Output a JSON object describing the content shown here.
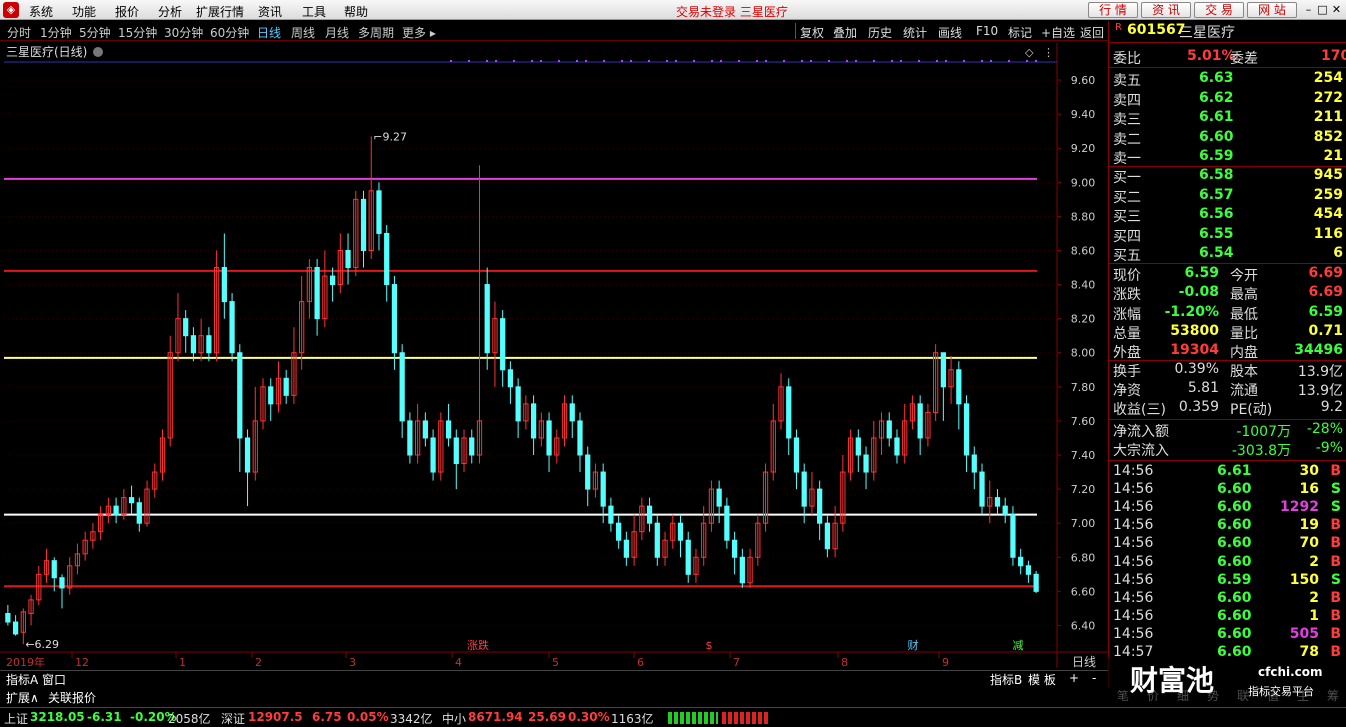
{
  "menu": {
    "items": [
      "系统",
      "功能",
      "报价",
      "分析",
      "扩展行情",
      "资讯",
      "工具",
      "帮助"
    ],
    "title": "交易未登录  三星医疗",
    "tabs": [
      "行 情",
      "资 讯",
      "交 易",
      "网 站"
    ]
  },
  "periods": [
    "分时",
    "1分钟",
    "5分钟",
    "15分钟",
    "30分钟",
    "60分钟",
    "日线",
    "周线",
    "月线",
    "多周期",
    "更多 ▸"
  ],
  "active_period": "日线",
  "tools": [
    "复权",
    "叠加",
    "历史",
    "统计",
    "画线",
    "F10",
    "标记",
    "+自选",
    "返回"
  ],
  "chart_title": "三星医疗(日线)",
  "chart_data": {
    "type": "candlestick",
    "title": "三星医疗(日线)",
    "ylim": [
      6.25,
      9.7
    ],
    "yticks": [
      "9.60",
      "9.40",
      "9.20",
      "9.00",
      "8.80",
      "8.60",
      "8.40",
      "8.20",
      "8.00",
      "7.80",
      "7.60",
      "7.40",
      "7.20",
      "7.00",
      "6.80",
      "6.60",
      "6.40"
    ],
    "x_year": "2019年",
    "x_months": [
      "12",
      "1",
      "2",
      "3",
      "4",
      "5",
      "6",
      "7",
      "8",
      "9"
    ],
    "hlines": [
      {
        "value": 9.02,
        "color": "#e040e0"
      },
      {
        "value": 8.48,
        "color": "#e01818"
      },
      {
        "value": 7.97,
        "color": "#ffff80"
      },
      {
        "value": 7.05,
        "color": "#ffffff"
      },
      {
        "value": 6.63,
        "color": "#e01818"
      }
    ],
    "annotations": [
      {
        "text": "9.27",
        "value": 9.27
      },
      {
        "text": "6.29",
        "value": 6.29
      }
    ],
    "events": [
      "涨跌",
      "$",
      "财",
      "减"
    ],
    "candles": [
      [
        6.47,
        6.42,
        6.52,
        6.4
      ],
      [
        6.42,
        6.35,
        6.46,
        6.34
      ],
      [
        6.36,
        6.48,
        6.5,
        6.29
      ],
      [
        6.47,
        6.55,
        6.58,
        6.4
      ],
      [
        6.55,
        6.7,
        6.75,
        6.52
      ],
      [
        6.7,
        6.78,
        6.85,
        6.65
      ],
      [
        6.78,
        6.68,
        6.8,
        6.6
      ],
      [
        6.68,
        6.62,
        6.7,
        6.5
      ],
      [
        6.62,
        6.75,
        6.8,
        6.58
      ],
      [
        6.75,
        6.82,
        6.88,
        6.7
      ],
      [
        6.82,
        6.9,
        6.95,
        6.78
      ],
      [
        6.9,
        6.95,
        7.0,
        6.85
      ],
      [
        6.95,
        7.05,
        7.1,
        6.9
      ],
      [
        7.05,
        7.1,
        7.15,
        7.0
      ],
      [
        7.1,
        7.05,
        7.15,
        7.0
      ],
      [
        7.05,
        7.15,
        7.2,
        7.02
      ],
      [
        7.15,
        7.12,
        7.22,
        7.05
      ],
      [
        7.12,
        7.0,
        7.15,
        6.95
      ],
      [
        7.0,
        7.2,
        7.25,
        6.98
      ],
      [
        7.2,
        7.3,
        7.35,
        7.15
      ],
      [
        7.3,
        7.5,
        7.55,
        7.25
      ],
      [
        7.5,
        8.0,
        8.1,
        7.45
      ],
      [
        8.0,
        8.2,
        8.35,
        7.95
      ],
      [
        8.2,
        8.1,
        8.25,
        8.0
      ],
      [
        8.1,
        8.0,
        8.15,
        7.95
      ],
      [
        8.0,
        8.1,
        8.2,
        7.95
      ],
      [
        8.1,
        8.0,
        8.15,
        7.95
      ],
      [
        8.0,
        8.5,
        8.6,
        7.95
      ],
      [
        8.5,
        8.3,
        8.7,
        8.2
      ],
      [
        8.3,
        8.0,
        8.35,
        7.95
      ],
      [
        8.0,
        7.5,
        8.05,
        7.3
      ],
      [
        7.5,
        7.3,
        7.55,
        7.1
      ],
      [
        7.3,
        7.6,
        7.8,
        7.25
      ],
      [
        7.6,
        7.8,
        7.85,
        7.55
      ],
      [
        7.8,
        7.7,
        7.85,
        7.6
      ],
      [
        7.7,
        7.85,
        7.95,
        7.65
      ],
      [
        7.85,
        7.75,
        7.9,
        7.7
      ],
      [
        7.75,
        8.0,
        8.15,
        7.7
      ],
      [
        8.0,
        8.3,
        8.45,
        7.9
      ],
      [
        8.3,
        8.5,
        8.55,
        8.2
      ],
      [
        8.5,
        8.2,
        8.55,
        8.1
      ],
      [
        8.2,
        8.45,
        8.6,
        8.15
      ],
      [
        8.45,
        8.4,
        8.5,
        8.3
      ],
      [
        8.4,
        8.6,
        8.7,
        8.35
      ],
      [
        8.6,
        8.5,
        8.7,
        8.4
      ],
      [
        8.5,
        8.9,
        8.95,
        8.45
      ],
      [
        8.9,
        8.6,
        8.95,
        8.5
      ],
      [
        8.6,
        8.95,
        9.27,
        8.55
      ],
      [
        8.95,
        8.7,
        9.0,
        8.6
      ],
      [
        8.7,
        8.4,
        8.75,
        8.3
      ],
      [
        8.4,
        8.0,
        8.45,
        7.9
      ],
      [
        8.0,
        7.6,
        8.05,
        7.5
      ],
      [
        7.6,
        7.4,
        7.65,
        7.35
      ],
      [
        7.4,
        7.6,
        7.7,
        7.35
      ],
      [
        7.6,
        7.5,
        7.65,
        7.45
      ],
      [
        7.5,
        7.3,
        7.55,
        7.25
      ],
      [
        7.3,
        7.6,
        7.65,
        7.25
      ],
      [
        7.6,
        7.5,
        7.7,
        7.45
      ],
      [
        7.5,
        7.35,
        7.55,
        7.2
      ],
      [
        7.35,
        7.5,
        7.55,
        7.3
      ],
      [
        7.5,
        7.4,
        7.55,
        7.35
      ],
      [
        7.4,
        7.6,
        9.1,
        7.35
      ],
      [
        8.4,
        8.0,
        8.5,
        7.9
      ],
      [
        8.0,
        8.2,
        8.3,
        7.8
      ],
      [
        8.2,
        7.9,
        8.25,
        7.8
      ],
      [
        7.9,
        7.8,
        7.95,
        7.7
      ],
      [
        7.8,
        7.6,
        7.85,
        7.5
      ],
      [
        7.6,
        7.7,
        7.75,
        7.55
      ],
      [
        7.7,
        7.5,
        7.75,
        7.4
      ],
      [
        7.5,
        7.6,
        7.65,
        7.45
      ],
      [
        7.6,
        7.4,
        7.65,
        7.3
      ],
      [
        7.4,
        7.5,
        7.55,
        7.35
      ],
      [
        7.5,
        7.7,
        7.75,
        7.45
      ],
      [
        7.7,
        7.6,
        7.75,
        7.5
      ],
      [
        7.6,
        7.4,
        7.65,
        7.3
      ],
      [
        7.4,
        7.2,
        7.45,
        7.1
      ],
      [
        7.2,
        7.3,
        7.35,
        7.15
      ],
      [
        7.3,
        7.1,
        7.35,
        7.0
      ],
      [
        7.1,
        7.0,
        7.15,
        6.95
      ],
      [
        7.0,
        6.9,
        7.05,
        6.85
      ],
      [
        6.9,
        6.8,
        6.95,
        6.75
      ],
      [
        6.8,
        6.95,
        7.05,
        6.75
      ],
      [
        6.95,
        7.1,
        7.15,
        6.9
      ],
      [
        7.1,
        7.0,
        7.15,
        6.95
      ],
      [
        7.0,
        6.8,
        7.05,
        6.75
      ],
      [
        6.8,
        6.9,
        6.95,
        6.75
      ],
      [
        6.9,
        7.0,
        7.05,
        6.85
      ],
      [
        7.0,
        6.9,
        7.05,
        6.8
      ],
      [
        6.9,
        6.7,
        6.95,
        6.65
      ],
      [
        6.7,
        6.8,
        6.85,
        6.65
      ],
      [
        6.8,
        7.0,
        7.1,
        6.75
      ],
      [
        7.0,
        7.2,
        7.25,
        6.95
      ],
      [
        7.2,
        7.1,
        7.25,
        7.0
      ],
      [
        7.1,
        6.9,
        7.15,
        6.85
      ],
      [
        6.9,
        6.8,
        6.95,
        6.7
      ],
      [
        6.8,
        6.65,
        6.85,
        6.62
      ],
      [
        6.65,
        6.8,
        6.85,
        6.62
      ],
      [
        6.8,
        7.0,
        7.05,
        6.75
      ],
      [
        7.0,
        7.3,
        7.35,
        6.95
      ],
      [
        7.3,
        7.6,
        7.7,
        7.25
      ],
      [
        7.6,
        7.8,
        7.88,
        7.55
      ],
      [
        7.8,
        7.5,
        7.85,
        7.4
      ],
      [
        7.5,
        7.3,
        7.55,
        7.2
      ],
      [
        7.3,
        7.1,
        7.35,
        7.0
      ],
      [
        7.1,
        7.2,
        7.3,
        7.05
      ],
      [
        7.2,
        7.0,
        7.25,
        6.9
      ],
      [
        7.0,
        6.85,
        7.05,
        6.8
      ],
      [
        6.85,
        7.0,
        7.1,
        6.8
      ],
      [
        7.0,
        7.3,
        7.4,
        6.95
      ],
      [
        7.3,
        7.5,
        7.55,
        7.25
      ],
      [
        7.5,
        7.4,
        7.55,
        7.3
      ],
      [
        7.4,
        7.3,
        7.45,
        7.2
      ],
      [
        7.3,
        7.5,
        7.6,
        7.25
      ],
      [
        7.5,
        7.6,
        7.65,
        7.4
      ],
      [
        7.6,
        7.5,
        7.65,
        7.45
      ],
      [
        7.5,
        7.4,
        7.55,
        7.35
      ],
      [
        7.4,
        7.6,
        7.7,
        7.35
      ],
      [
        7.6,
        7.7,
        7.75,
        7.55
      ],
      [
        7.7,
        7.5,
        7.75,
        7.4
      ],
      [
        7.5,
        7.65,
        7.7,
        7.45
      ],
      [
        7.65,
        8.0,
        8.05,
        7.6
      ],
      [
        8.0,
        7.8,
        8.0,
        7.6
      ],
      [
        7.8,
        7.9,
        7.98,
        7.7
      ],
      [
        7.9,
        7.7,
        7.95,
        7.55
      ],
      [
        7.7,
        7.4,
        7.75,
        7.3
      ],
      [
        7.4,
        7.3,
        7.45,
        7.2
      ],
      [
        7.3,
        7.1,
        7.35,
        7.05
      ],
      [
        7.1,
        7.15,
        7.25,
        7.0
      ],
      [
        7.15,
        7.1,
        7.2,
        7.05
      ],
      [
        7.1,
        7.05,
        7.15,
        7.0
      ],
      [
        7.05,
        6.8,
        7.1,
        6.75
      ],
      [
        6.8,
        6.75,
        6.85,
        6.7
      ],
      [
        6.75,
        6.7,
        6.78,
        6.65
      ],
      [
        6.7,
        6.6,
        6.72,
        6.59
      ]
    ]
  },
  "quote": {
    "code": "601567",
    "name": "三星医疗",
    "weibi_label": "委比",
    "weibi": "5.01%",
    "weicha_label": "委差",
    "weicha": "170",
    "asks": [
      {
        "label": "卖五",
        "price": "6.63",
        "vol": "254"
      },
      {
        "label": "卖四",
        "price": "6.62",
        "vol": "272"
      },
      {
        "label": "卖三",
        "price": "6.61",
        "vol": "211"
      },
      {
        "label": "卖二",
        "price": "6.60",
        "vol": "852"
      },
      {
        "label": "卖一",
        "price": "6.59",
        "vol": "21"
      }
    ],
    "bids": [
      {
        "label": "买一",
        "price": "6.58",
        "vol": "945"
      },
      {
        "label": "买二",
        "price": "6.57",
        "vol": "259"
      },
      {
        "label": "买三",
        "price": "6.56",
        "vol": "454"
      },
      {
        "label": "买四",
        "price": "6.55",
        "vol": "116"
      },
      {
        "label": "买五",
        "price": "6.54",
        "vol": "6"
      }
    ],
    "stats": [
      {
        "l1": "现价",
        "v1": "6.59",
        "c1": "dn",
        "l2": "今开",
        "v2": "6.69",
        "c2": "up"
      },
      {
        "l1": "涨跌",
        "v1": "-0.08",
        "c1": "dn",
        "l2": "最高",
        "v2": "6.69",
        "c2": "up"
      },
      {
        "l1": "涨幅",
        "v1": "-1.20%",
        "c1": "dn",
        "l2": "最低",
        "v2": "6.59",
        "c2": "dn"
      },
      {
        "l1": "总量",
        "v1": "53800",
        "c1": "yl",
        "l2": "量比",
        "v2": "0.71",
        "c2": "yl"
      },
      {
        "l1": "外盘",
        "v1": "19304",
        "c1": "up",
        "l2": "内盘",
        "v2": "34496",
        "c2": "dn"
      }
    ],
    "stats2": [
      {
        "l1": "换手",
        "v1": "0.39%",
        "l2": "股本",
        "v2": "13.9亿"
      },
      {
        "l1": "净资",
        "v1": "5.81",
        "l2": "流通",
        "v2": "13.9亿"
      },
      {
        "l1": "收益(三)",
        "v1": "0.359",
        "l2": "PE(动)",
        "v2": "9.2"
      }
    ],
    "flows": [
      {
        "label": "净流入额",
        "val": "-1007万",
        "pct": "-28%"
      },
      {
        "label": "大宗流入",
        "val": "-303.8万",
        "pct": "-9%"
      }
    ],
    "ticks": [
      {
        "t": "14:56",
        "p": "6.61",
        "v": "30",
        "s": "B"
      },
      {
        "t": "14:56",
        "p": "6.60",
        "v": "16",
        "s": "S"
      },
      {
        "t": "14:56",
        "p": "6.60",
        "v": "1292",
        "s": "S"
      },
      {
        "t": "14:56",
        "p": "6.60",
        "v": "19",
        "s": "B"
      },
      {
        "t": "14:56",
        "p": "6.60",
        "v": "70",
        "s": "B"
      },
      {
        "t": "14:56",
        "p": "6.60",
        "v": "2",
        "s": "B"
      },
      {
        "t": "14:56",
        "p": "6.59",
        "v": "150",
        "s": "S"
      },
      {
        "t": "14:56",
        "p": "6.60",
        "v": "2",
        "s": "B"
      },
      {
        "t": "14:56",
        "p": "6.60",
        "v": "1",
        "s": "B"
      },
      {
        "t": "14:56",
        "p": "6.60",
        "v": "505",
        "s": "B"
      },
      {
        "t": "14:57",
        "p": "6.60",
        "v": "78",
        "s": "B"
      }
    ],
    "tabs": [
      "笔",
      "价",
      "细",
      "势",
      "联",
      "值",
      "主",
      "筹"
    ]
  },
  "bottom": {
    "tabs": [
      "指标A",
      "窗口"
    ],
    "right": [
      "指标B",
      "模 板"
    ],
    "sub": [
      "扩展∧",
      "关联报价"
    ],
    "period": "日线"
  },
  "watermark": {
    "text": "财富池",
    "site": "cfchi.com",
    "slogan": "指标交易平台"
  },
  "status": [
    {
      "name": "上证",
      "price": "3218.05",
      "chg": "-6.31",
      "pct": "-0.20%",
      "amt": "2058亿"
    },
    {
      "name": "深证",
      "price": "12907.5",
      "chg": "6.75",
      "pct": "0.05%",
      "amt": "3342亿"
    },
    {
      "name": "中小",
      "price": "8671.94",
      "chg": "25.69",
      "pct": "0.30%",
      "amt": "1163亿"
    }
  ]
}
